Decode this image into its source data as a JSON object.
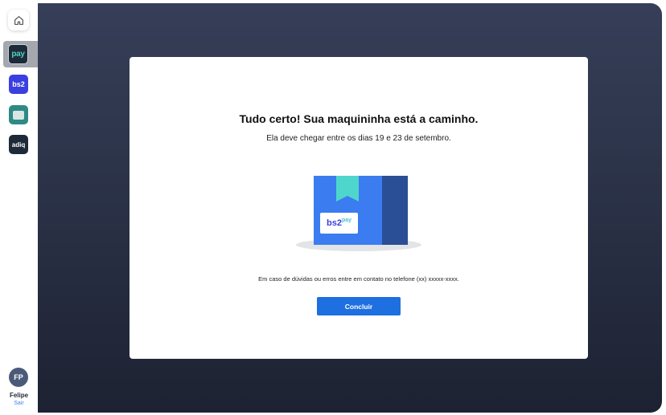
{
  "sidebar": {
    "home_icon": "home-icon",
    "apps": [
      {
        "name": "pay",
        "label": "pay",
        "color": "#1f2a38",
        "active": true
      },
      {
        "name": "bs2",
        "label": "bs2",
        "color": "#3b3fe0"
      },
      {
        "name": "card",
        "label": "",
        "color": "#2e8a85"
      },
      {
        "name": "adiq",
        "label": "adiq",
        "color": "#1f2a38"
      }
    ],
    "user": {
      "initials": "FP",
      "name": "Felipe",
      "logout_label": "Sair"
    }
  },
  "modal": {
    "title": "Tudo certo! Sua maquininha está a caminho.",
    "subtitle": "Ela deve chegar entre os dias 19 e 23 de setembro.",
    "box_label_main": "bs2",
    "box_label_sup": "pay",
    "contact_text": "Em caso de dúvidas ou erros entre em contato no telefone (xx) xxxxx-xxxx.",
    "confirm_label": "Concluir"
  },
  "colors": {
    "primary": "#1e6fe0",
    "background_dark": "#2a3146",
    "box_front": "#3b7cf0",
    "box_side": "#2a4f96",
    "ribbon": "#4fd6cc"
  }
}
